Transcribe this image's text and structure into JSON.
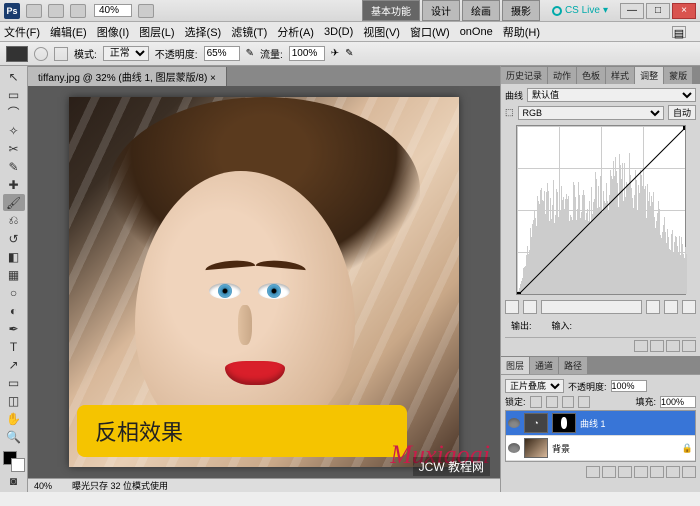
{
  "titlebar": {
    "ps": "Ps",
    "zoom": "40%",
    "workspaces": [
      "基本功能",
      "设计",
      "绘画",
      "摄影"
    ],
    "cslive": "CS Live",
    "min": "—",
    "max": "□",
    "close": "×"
  },
  "menu": [
    "文件(F)",
    "编辑(E)",
    "图像(I)",
    "图层(L)",
    "选择(S)",
    "滤镜(T)",
    "分析(A)",
    "3D(D)",
    "视图(V)",
    "窗口(W)",
    "onOne",
    "帮助(H)"
  ],
  "optbar": {
    "mode_label": "模式:",
    "mode": "正常",
    "opacity_label": "不透明度:",
    "opacity": "65%",
    "flow_label": "流量:",
    "flow": "100%"
  },
  "doc_tab": "tiffany.jpg @ 32% (曲线 1, 图层蒙版/8) ×",
  "annotation": "反相效果",
  "statusbar": {
    "zoom": "40%",
    "info": "曝光只存 32 位模式使用"
  },
  "panel_tabs_top": [
    "历史记录",
    "动作",
    "色板",
    "样式",
    "调整",
    "蒙版"
  ],
  "curves": {
    "preset_label": "曲线",
    "preset": "默认值",
    "channel_icon": "⬜",
    "channel": "RGB",
    "auto": "自动",
    "output_label": "输出:",
    "input_label": "输入:"
  },
  "panel_tabs_bottom": [
    "图层",
    "通道",
    "路径"
  ],
  "layers": {
    "blend": "正片叠底",
    "opacity_label": "不透明度:",
    "opacity": "100%",
    "lock_label": "锁定:",
    "fill_label": "填充:",
    "fill": "100%",
    "items": [
      {
        "name": "曲线 1"
      },
      {
        "name": "背景"
      }
    ]
  },
  "watermark": "Muxiaoai",
  "jcw": "JCW 教程网"
}
